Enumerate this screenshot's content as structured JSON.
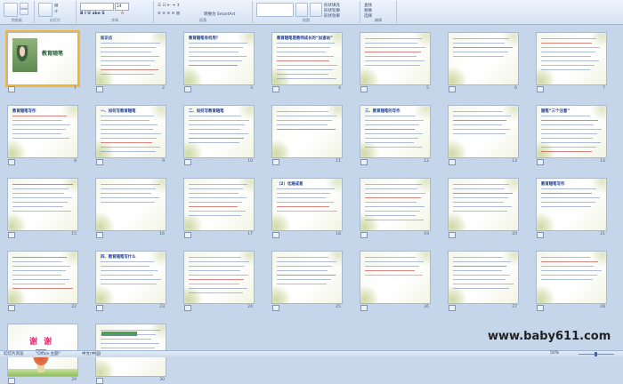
{
  "ribbon": {
    "groups": [
      {
        "label": "剪贴板"
      },
      {
        "label": "幻灯片"
      },
      {
        "label": "字体"
      },
      {
        "label": "段落"
      },
      {
        "label": "绘图"
      },
      {
        "label": "编辑"
      }
    ],
    "new_slide_label": "新建\n幻灯片",
    "font_size": "24",
    "convert_smartart": "转换为 SmartArt",
    "arrange_label": "排列",
    "quick_styles_label": "快速样式",
    "shape_fill": "形状填充",
    "shape_outline": "形状轮廓",
    "shape_effects": "形状效果",
    "find": "查找",
    "replace": "替换",
    "select": "选择"
  },
  "slides": [
    {
      "num": "1",
      "title": "教育随笔",
      "kind": "title",
      "selected": true
    },
    {
      "num": "2",
      "title": "知识点",
      "kind": "text"
    },
    {
      "num": "3",
      "title": "教育随笔有何用？",
      "kind": "text"
    },
    {
      "num": "4",
      "title": "教育随笔是教师成长的“加速站”",
      "kind": "text"
    },
    {
      "num": "5",
      "title": "",
      "kind": "text"
    },
    {
      "num": "6",
      "title": "",
      "kind": "text"
    },
    {
      "num": "7",
      "title": "",
      "kind": "text"
    },
    {
      "num": "8",
      "title": "教育随笔写作",
      "kind": "text"
    },
    {
      "num": "9",
      "title": "一、如何写教育随笔",
      "kind": "text"
    },
    {
      "num": "10",
      "title": "二、如何写教育随笔",
      "kind": "text"
    },
    {
      "num": "11",
      "title": "",
      "kind": "text"
    },
    {
      "num": "12",
      "title": "三、教育随笔的写作",
      "kind": "text"
    },
    {
      "num": "13",
      "title": "",
      "kind": "text"
    },
    {
      "num": "14",
      "title": "随笔“三个注意”",
      "kind": "text"
    },
    {
      "num": "15",
      "title": "",
      "kind": "text"
    },
    {
      "num": "16",
      "title": "",
      "kind": "text"
    },
    {
      "num": "17",
      "title": "",
      "kind": "text"
    },
    {
      "num": "18",
      "title": "（2）化难成易",
      "kind": "text"
    },
    {
      "num": "19",
      "title": "",
      "kind": "text"
    },
    {
      "num": "20",
      "title": "",
      "kind": "text"
    },
    {
      "num": "21",
      "title": "教育随笔写作",
      "kind": "text"
    },
    {
      "num": "22",
      "title": "",
      "kind": "text"
    },
    {
      "num": "23",
      "title": "四、教育随笔写什么",
      "kind": "text"
    },
    {
      "num": "24",
      "title": "",
      "kind": "text"
    },
    {
      "num": "25",
      "title": "",
      "kind": "text"
    },
    {
      "num": "26",
      "title": "",
      "kind": "text"
    },
    {
      "num": "27",
      "title": "",
      "kind": "text"
    },
    {
      "num": "28",
      "title": "",
      "kind": "text"
    },
    {
      "num": "29",
      "title": "谢 谢",
      "kind": "thanks"
    },
    {
      "num": "30",
      "title": "",
      "kind": "last"
    }
  ],
  "watermark": "www.baby611.com",
  "status": {
    "slide_view": "幻灯片浏览",
    "theme": "\"Office 主题\"",
    "language": "中文(中国)",
    "zoom": "50%"
  }
}
